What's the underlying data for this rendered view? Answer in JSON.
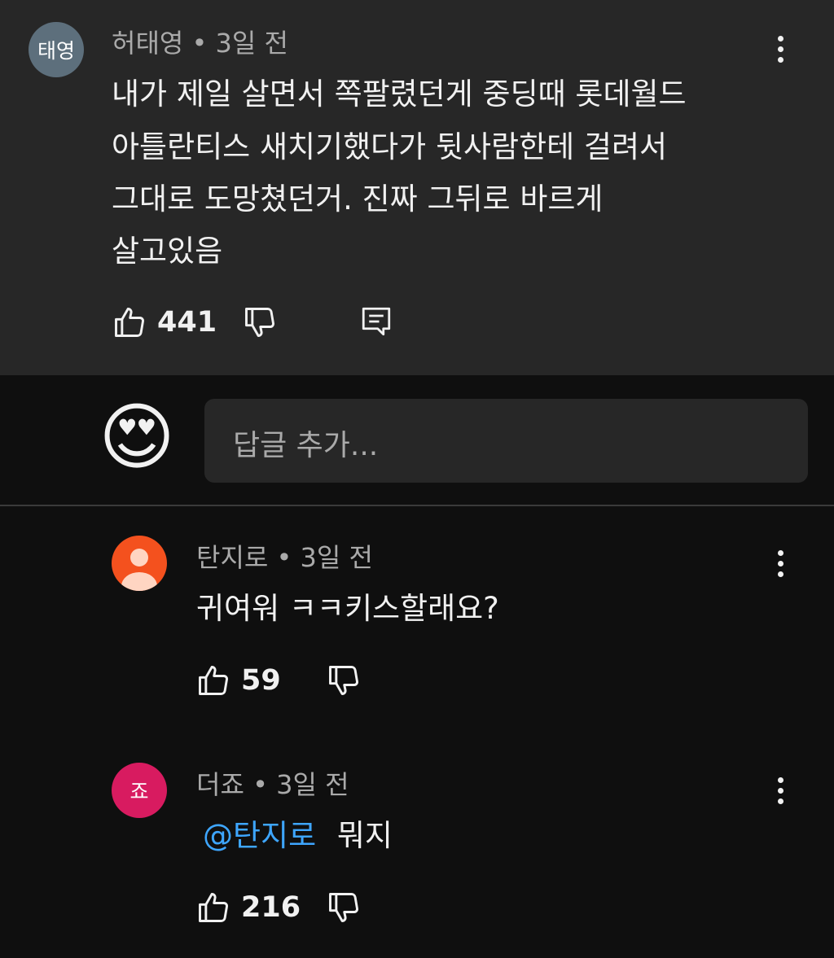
{
  "top_comment": {
    "avatar_text": "태영",
    "author": "허태영",
    "time": "3일 전",
    "lines": [
      "내가 제일 살면서 쪽팔렸던게 중딩때 롯데월드",
      "아틀란티스 새치기했다가 뒷사람한테 걸려서",
      "그대로 도망쳤던거. 진짜 그뒤로 바르게",
      "살고있음"
    ],
    "likes": "441"
  },
  "reply_input": {
    "emoji": "😍",
    "placeholder": "답글 추가..."
  },
  "replies": [
    {
      "author": "탄지로",
      "time": "3일 전",
      "text": "귀여워 ㅋㅋ키스할래요?",
      "likes": "59"
    },
    {
      "avatar_text": "죠",
      "author": "더죠",
      "time": "3일 전",
      "mention": "@탄지로",
      "text": "뭐지",
      "likes": "216"
    }
  ],
  "colors": {
    "top_bg": "#272727",
    "page_bg": "#0f0f0f",
    "mention": "#3ea6ff",
    "avatar_top": "#5d6f7c",
    "avatar_reply1": "#f4511e",
    "avatar_reply2": "#d81b60"
  }
}
